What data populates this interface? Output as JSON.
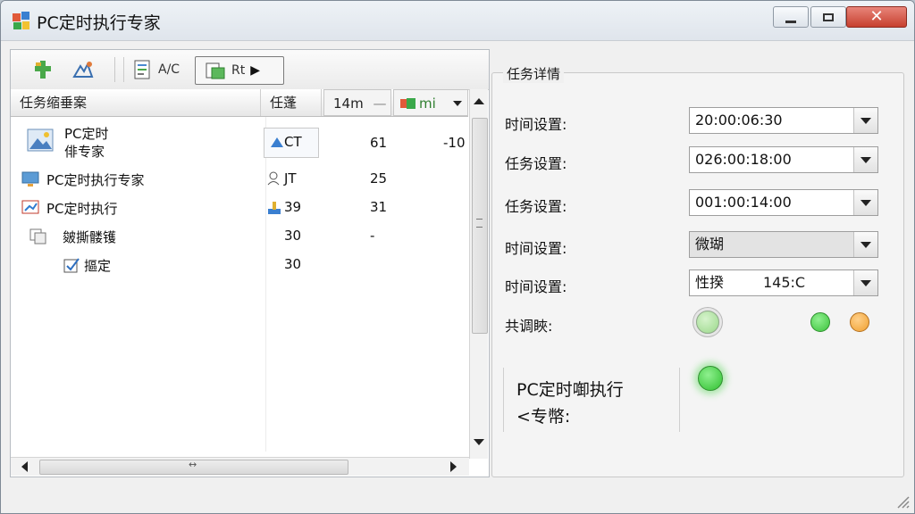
{
  "window": {
    "title": "PC定时执行专家",
    "close_glyph": "✕"
  },
  "toolbar": {
    "btn3_label": "A/C",
    "btn4_label": "Rt",
    "btn4_arrow": "▶"
  },
  "columns": {
    "c1": "任务缩垂案",
    "c2": "任蓬",
    "c3": "14m",
    "c3_sep": "—",
    "c4": "mi"
  },
  "rows": [
    {
      "name_line1": "PC定时",
      "name_line2": "俳专家",
      "col2": "CT",
      "col3": "61",
      "col4": "-10"
    },
    {
      "name": "PC定时执行专家",
      "col2": "JT",
      "col3": "25",
      "col4": ""
    },
    {
      "name": "PC定时执行",
      "col2": "39",
      "col3": "31",
      "col4": ""
    },
    {
      "name": "皴撕髅镬",
      "col2": "30",
      "col3": "-",
      "col4": ""
    },
    {
      "name": "摳定",
      "col2": "30",
      "col3": "",
      "col4": ""
    }
  ],
  "hscroll_center": "↔",
  "details": {
    "legend": "任务详情",
    "fields": [
      {
        "label": "时间设置:",
        "value": "20:00:06:30"
      },
      {
        "label": "任务设置:",
        "value": "026:00:18:00"
      },
      {
        "label": "任务设置:",
        "value": "001:00:14:00"
      },
      {
        "label": "时间设置:",
        "value": "微瑚"
      },
      {
        "label": "时间设置:",
        "value": "性揆",
        "value2": "145:C"
      }
    ],
    "status_label": "共调䀹:",
    "status_line1": "PC定时啣执行",
    "status_line2": "<专幣:"
  },
  "colors": {
    "green": "#3cc23c",
    "light_green": "#9ad88a",
    "orange": "#f0a030",
    "close_red": "#c7402f"
  }
}
